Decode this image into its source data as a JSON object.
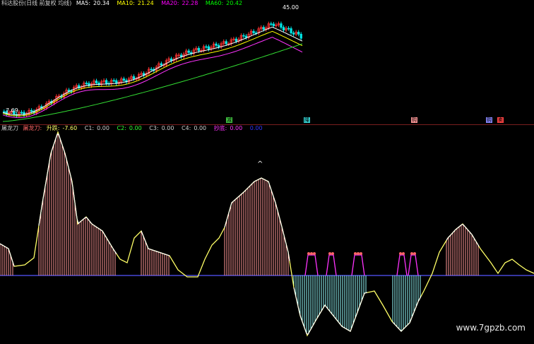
{
  "top_header": {
    "title": "科达股份(日线 前复权 均线)",
    "ma5_label": "MA5:",
    "ma5_value": "20.34",
    "ma10_label": "MA10:",
    "ma10_value": "21.24",
    "ma20_label": "MA20:",
    "ma20_value": "22.28",
    "ma60_label": "MA60:",
    "ma60_value": "20.42",
    "colors": {
      "title": "#cfcfcf",
      "ma5": "#ffffff",
      "ma10": "#ffff00",
      "ma20": "#ff00ff",
      "ma60": "#00ff00"
    }
  },
  "price_labels": {
    "high": "45.00",
    "low": "7.69"
  },
  "markers": [
    {
      "text": "减",
      "color": "#3fbf3f"
    },
    {
      "text": "降",
      "color": "#33cccc"
    },
    {
      "text": "购",
      "color": "#ff9999"
    },
    {
      "text": "购",
      "color": "#8888ff"
    },
    {
      "text": "卖",
      "color": "#ff4444"
    }
  ],
  "bottom_header": {
    "name": "屠龙刀",
    "param": "屠龙刀:",
    "rise_label": "升跌:",
    "rise_value": "-7.60",
    "c1_label": "C1:",
    "c1_value": "0.00",
    "c2_label": "C2:",
    "c2_value": "0.00",
    "c3_label": "C3:",
    "c3_value": "0.00",
    "c4_label": "C4:",
    "c4_value": "0.00",
    "chao_label": "抄底:",
    "chao_value": "0.00",
    "last_value": "0.00"
  },
  "watermark": "www.7gpzb.com"
}
